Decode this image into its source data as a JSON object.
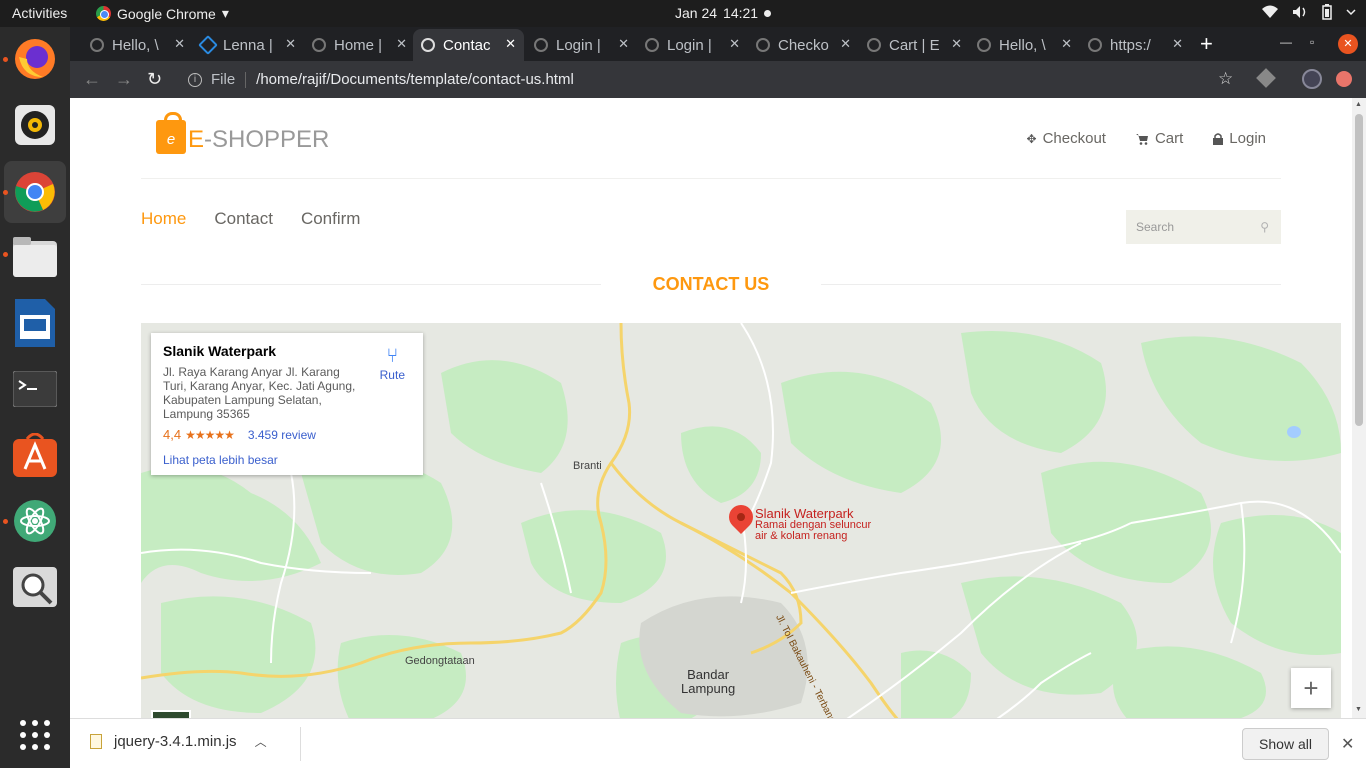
{
  "system": {
    "activities": "Activities",
    "app_name": "Google Chrome",
    "app_menu_arrow": "▾",
    "date": "Jan 24",
    "time": "14:21"
  },
  "tabs": [
    {
      "label": "Hello, \\",
      "active": false
    },
    {
      "label": "Lenna |",
      "active": false
    },
    {
      "label": "Home |",
      "active": false
    },
    {
      "label": "Contac",
      "active": true
    },
    {
      "label": "Login |",
      "active": false
    },
    {
      "label": "Login |",
      "active": false
    },
    {
      "label": "Checko",
      "active": false
    },
    {
      "label": "Cart | E",
      "active": false
    },
    {
      "label": "Hello, \\",
      "active": false
    },
    {
      "label": "https:/",
      "active": false
    }
  ],
  "toolbar": {
    "scheme": "File",
    "url": "/home/rajif/Documents/template/contact-us.html"
  },
  "site": {
    "logo_e": "E",
    "logo_rest": "-SHOPPER",
    "logo_bag_letter": "e",
    "header_links": [
      "Checkout",
      "Cart",
      "Login"
    ],
    "nav": [
      "Home",
      "Contact",
      "Confirm"
    ],
    "search_placeholder": "Search",
    "section_title": "CONTACT US"
  },
  "map": {
    "place_name": "Slanik Waterpark",
    "address": "Jl. Raya Karang Anyar Jl. Karang Turi, Karang Anyar, Kec. Jati Agung, Kabupaten Lampung Selatan, Lampung 35365",
    "rating": "4,4",
    "stars": "★★★★★",
    "reviews": "3.459 review",
    "bigger_map": "Lihat peta lebih besar",
    "route_label": "Rute",
    "pin_title": "Slanik Waterpark",
    "pin_sub_1": "Ramai dengan seluncur",
    "pin_sub_2": "air & kolam renang",
    "places": {
      "branti": "Branti",
      "gedong": "Gedongtataan",
      "bandar_1": "Bandar",
      "bandar_2": "Lampung"
    },
    "road_label": "Jl. Tol Bakauheni - Terbanggi Besar",
    "zoom_in": "+"
  },
  "downloads": {
    "file": "jquery-3.4.1.min.js",
    "show_all": "Show all"
  },
  "colors": {
    "accent": "#fe980f",
    "map_bg": "#e6e8e2",
    "map_green": "#c6ecc2",
    "road_yellow": "#f5d46b"
  }
}
